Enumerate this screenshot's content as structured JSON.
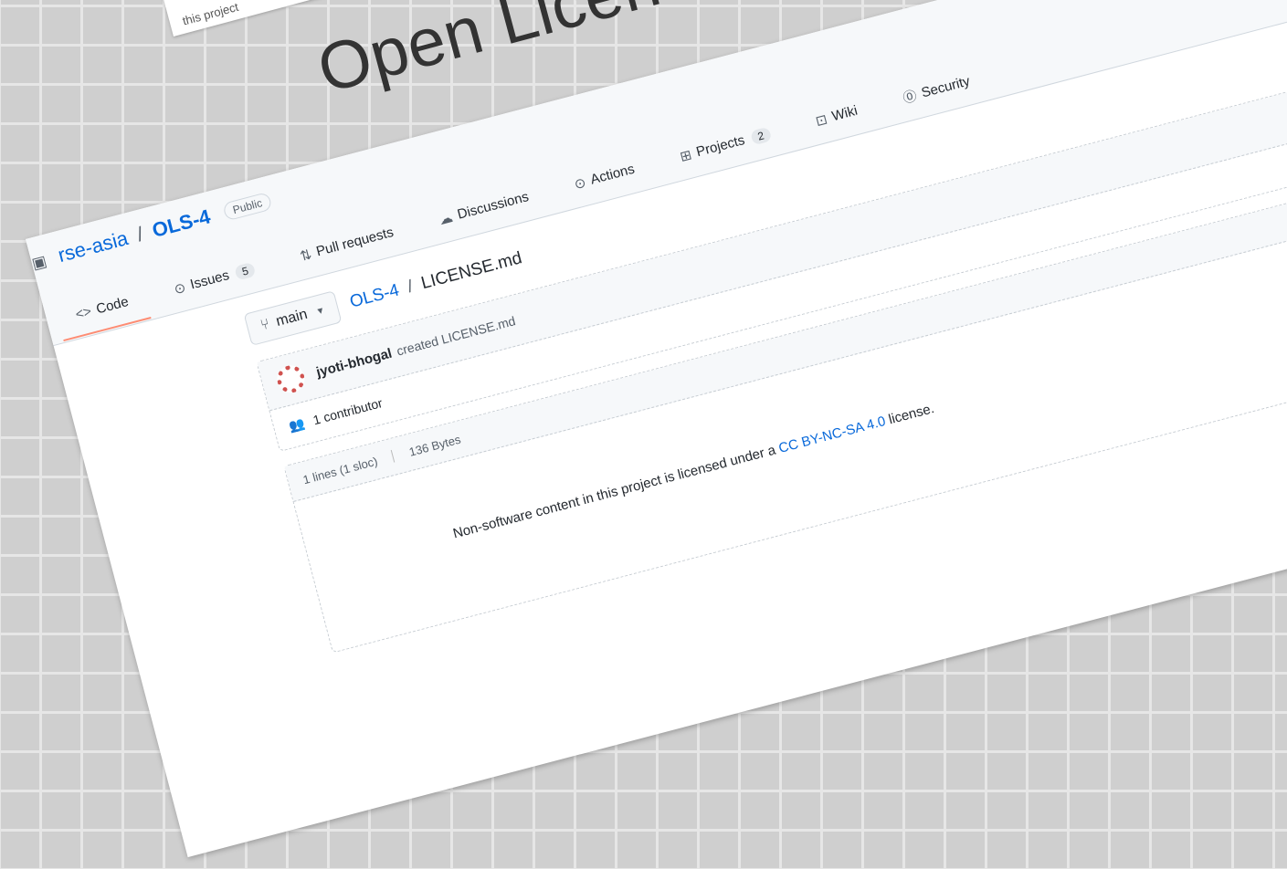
{
  "background_card": {
    "text": "this project"
  },
  "title": "Open License",
  "repo": {
    "owner": "rse-asia",
    "separator": "/",
    "name": "OLS-4",
    "visibility": "Public"
  },
  "nav": [
    {
      "label": "Code",
      "icon": "code-icon",
      "glyph": "<>",
      "count": null,
      "active": true
    },
    {
      "label": "Issues",
      "icon": "issue-icon",
      "glyph": "⊙",
      "count": "5",
      "active": false
    },
    {
      "label": "Pull requests",
      "icon": "pull-request-icon",
      "glyph": "⇅",
      "count": null,
      "active": false
    },
    {
      "label": "Discussions",
      "icon": "discussions-icon",
      "glyph": "☁",
      "count": null,
      "active": false
    },
    {
      "label": "Actions",
      "icon": "play-icon",
      "glyph": "⊙",
      "count": null,
      "active": false
    },
    {
      "label": "Projects",
      "icon": "projects-icon",
      "glyph": "⊞",
      "count": "2",
      "active": false
    },
    {
      "label": "Wiki",
      "icon": "book-icon",
      "glyph": "⊡",
      "count": null,
      "active": false
    },
    {
      "label": "Security",
      "icon": "shield-icon",
      "glyph": "⓪",
      "count": null,
      "active": false
    }
  ],
  "branch": {
    "name": "main"
  },
  "path": {
    "repo": "OLS-4",
    "separator": "/",
    "file": "LICENSE.md"
  },
  "commit": {
    "author": "jyoti-bhogal",
    "message": "created LICENSE.md"
  },
  "contributors": {
    "text": "1 contributor"
  },
  "file_info": {
    "lines": "1 lines (1 sloc)",
    "size": "136 Bytes"
  },
  "license": {
    "prefix": "Non-software content in this project is licensed under a",
    "link": "CC BY-NC-SA 4.0",
    "suffix": "license."
  },
  "colors": {
    "link": "#0969da",
    "active_tab_underline": "#fd8c73",
    "header_bg": "#f6f8fa",
    "avatar": "#d0524f"
  }
}
